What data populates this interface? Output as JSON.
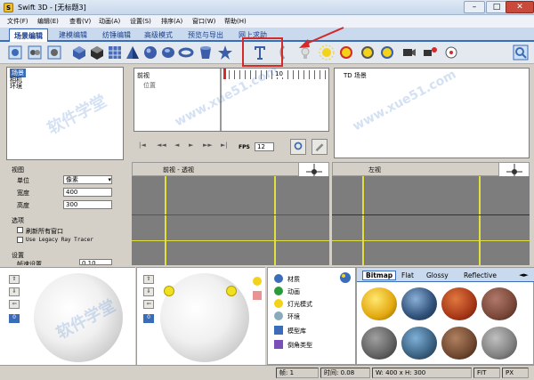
{
  "window": {
    "title": "Swift 3D - [无标题3]",
    "icon_letter": "S",
    "min": "–",
    "max": "□",
    "close": "✕"
  },
  "menu": [
    "文件(F)",
    "编辑(E)",
    "查看(V)",
    "动画(A)",
    "设置(S)",
    "排序(A)",
    "窗口(W)",
    "帮助(H)"
  ],
  "tabs": {
    "active": "场景编辑",
    "others": [
      "建模编辑",
      "纺锤编辑",
      "高级模式",
      "预览与导出",
      "网上求助"
    ]
  },
  "outline": {
    "items": [
      "场景",
      "相机",
      "环境"
    ]
  },
  "timeline": {
    "title": "前视",
    "row": "位置",
    "ruler": "10",
    "fps_label": "FPS",
    "fps_value": "12"
  },
  "scene_tree": {
    "root": "TD 场景"
  },
  "viewports": {
    "left": "前视 - 透视",
    "right": "左视"
  },
  "props": {
    "group1": "视图",
    "unit_label": "单位",
    "unit_value": "像素",
    "width_label": "宽度",
    "width_value": "400",
    "height_label": "高度",
    "height_value": "300",
    "group2": "选项",
    "opt1": "刷新所有窗口",
    "opt2": "Use Legacy Ray Tracer",
    "group3": "设置",
    "anim_label": "帧速设置",
    "anim_value": "0.10"
  },
  "gallery": {
    "tabs": [
      "Bitmap",
      "Flat",
      "Glossy",
      "Reflective"
    ],
    "arrows": "◄►"
  },
  "lighting_list": [
    "材质",
    "动画",
    "灯光模式",
    "环境",
    "模型库",
    "倒角类型"
  ],
  "status": {
    "frame": "帧: 1",
    "time": "时间: 0.08",
    "size": "W: 400 x H: 300",
    "fit": "FIT",
    "px": "PX"
  },
  "watermarks": [
    "软件学堂",
    "www.xue51.com",
    "软件学堂",
    "www.xue51.com"
  ],
  "colors": {
    "accent": "#3a6cb8",
    "highlight": "#d42a2a",
    "viewport_bg": "#7d7d7d",
    "grid_yellow": "#e2e040",
    "grid_red": "#d42020",
    "grid_blue": "#2020c8"
  }
}
